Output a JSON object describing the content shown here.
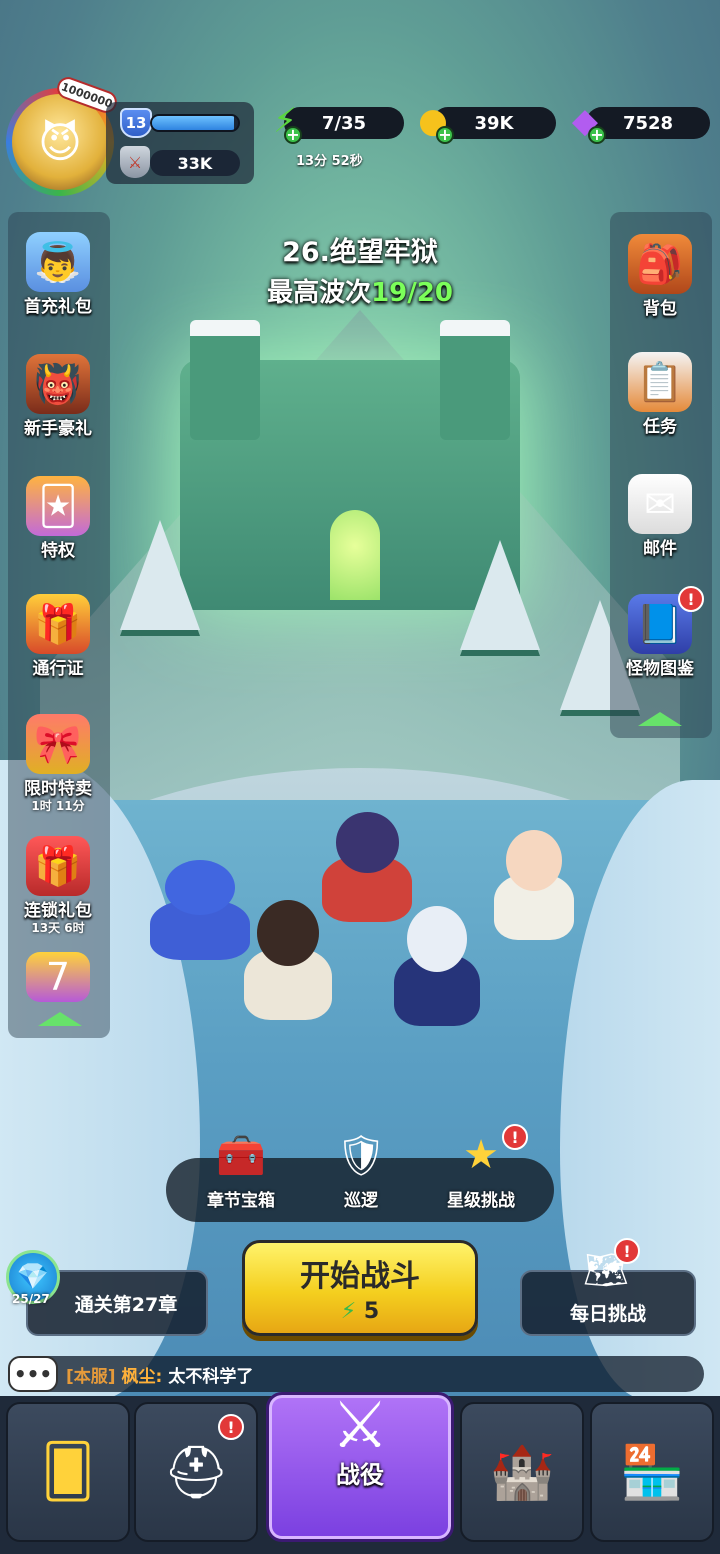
{
  "player": {
    "avatar_icon": "hero-avatar",
    "badge_value": "1000000",
    "level": "13",
    "xp_fraction": 0.95,
    "power": "33K"
  },
  "resources": {
    "energy": {
      "value": "7/35",
      "timer": "13分 52秒",
      "icon": "energy-bolt-icon"
    },
    "coins": {
      "value": "39K",
      "icon": "coin-icon"
    },
    "gems": {
      "value": "7528",
      "icon": "gem-icon"
    }
  },
  "stage": {
    "title": "26.绝望牢狱",
    "wave_label": "最高波次",
    "wave_value": "19/20"
  },
  "left_menu": {
    "items": [
      {
        "label": "首充礼包"
      },
      {
        "label": "新手豪礼"
      },
      {
        "label": "特权"
      },
      {
        "label": "通行证"
      },
      {
        "label": "限时特卖",
        "sub": "1时 11分"
      },
      {
        "label": "连锁礼包",
        "sub": "13天 6时"
      }
    ]
  },
  "right_menu": {
    "items": [
      {
        "label": "背包"
      },
      {
        "label": "任务"
      },
      {
        "label": "邮件"
      },
      {
        "label": "怪物图鉴",
        "alert": "!"
      }
    ]
  },
  "features": {
    "chest": {
      "label": "章节宝箱"
    },
    "patrol": {
      "label": "巡逻"
    },
    "star": {
      "label": "星级挑战",
      "alert": "!"
    }
  },
  "actions": {
    "chapter_progress": "25/27",
    "chapter_label": "通关第27章",
    "start_label": "开始战斗",
    "start_cost": "5",
    "daily_label": "每日挑战",
    "daily_alert": "!"
  },
  "chat": {
    "channel": "[本服]",
    "name": "枫尘:",
    "message": "太不科学了"
  },
  "nav": {
    "tabs": [
      {
        "name": "cards"
      },
      {
        "name": "heroes",
        "alert": "!"
      },
      {
        "name": "campaign",
        "label": "战役"
      },
      {
        "name": "castle"
      },
      {
        "name": "shop"
      }
    ]
  },
  "colors": {
    "accent_green": "#7bff5a",
    "start_button": "#f4cf1f",
    "campaign_tab": "#9a57f0",
    "alert_red": "#e23838"
  }
}
